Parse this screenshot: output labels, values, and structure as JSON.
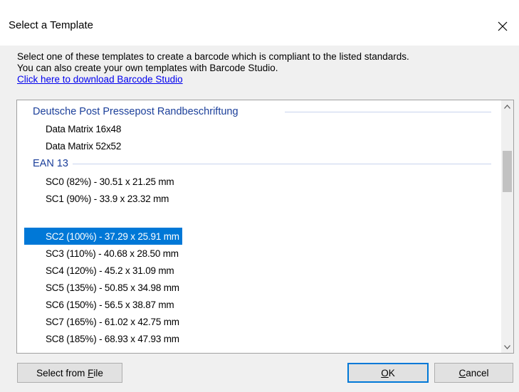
{
  "window": {
    "title": "Select a Template",
    "close_icon": "close-icon"
  },
  "description": {
    "line1": "Select one of these templates to create a barcode which is compliant to the listed standards.",
    "line2": "You can also create your own templates with Barcode Studio.",
    "link": "Click here to download Barcode Studio"
  },
  "colors": {
    "group_header": "#1b3f9a",
    "selection": "#0078d7",
    "link": "#0000ee"
  },
  "groups": [
    {
      "name": "Deutsche Post Pressepost Randbeschriftung",
      "items": [
        "Data Matrix 16x48",
        "Data Matrix 52x52"
      ]
    },
    {
      "name": "EAN 13",
      "items": [
        "SC0 (82%) - 30.51 x 21.25 mm",
        "SC1 (90%) - 33.9 x 23.32 mm",
        "SC2 (100%) - 37.29 x 25.91 mm",
        "SC3 (110%) - 40.68 x 28.50 mm",
        "SC4 (120%) - 45.2 x 31.09 mm",
        "SC5 (135%) - 50.85 x 34.98  mm",
        "SC6 (150%) - 56.5 x 38.87 mm",
        "SC7 (165%) - 61.02 x 42.75 mm",
        "SC8 (185%) - 68.93 x 47.93 mm"
      ]
    }
  ],
  "selected_item": "SC2 (100%) - 37.29 x 25.91 mm",
  "buttons": {
    "select_from_file_prefix": "Select from ",
    "select_from_file_accel": "F",
    "select_from_file_suffix": "ile",
    "ok_accel": "O",
    "ok_suffix": "K",
    "cancel_accel": "C",
    "cancel_suffix": "ancel"
  }
}
